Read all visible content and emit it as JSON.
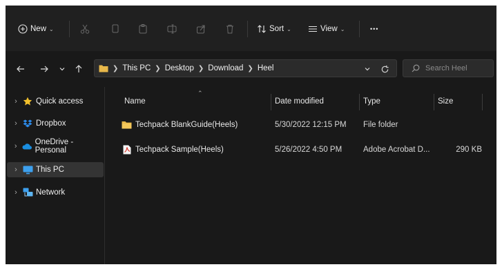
{
  "toolbar": {
    "new_label": "New",
    "sort_label": "Sort",
    "view_label": "View",
    "more_label": "•••"
  },
  "address": {
    "crumbs": [
      "This PC",
      "Desktop",
      "Download",
      "Heel"
    ]
  },
  "search": {
    "placeholder": "Search Heel"
  },
  "sidebar": {
    "items": [
      {
        "label": "Quick access",
        "icon": "star-icon"
      },
      {
        "label": "Dropbox",
        "icon": "dropbox-icon"
      },
      {
        "label": "OneDrive - Personal",
        "icon": "cloud-icon"
      },
      {
        "label": "This PC",
        "icon": "monitor-icon"
      },
      {
        "label": "Network",
        "icon": "network-icon"
      }
    ]
  },
  "columns": {
    "name": "Name",
    "date": "Date modified",
    "type": "Type",
    "size": "Size"
  },
  "files": [
    {
      "name": "Techpack BlankGuide(Heels)",
      "date": "5/30/2022 12:15 PM",
      "type": "File folder",
      "size": "",
      "icon": "folder-icon"
    },
    {
      "name": "Techpack Sample(Heels)",
      "date": "5/26/2022 4:50 PM",
      "type": "Adobe Acrobat D...",
      "size": "290 KB",
      "icon": "pdf-icon"
    }
  ],
  "colors": {
    "accent": "#0078d4",
    "folder": "#e8b84a",
    "star": "#f2c02c",
    "window_bg": "#191919",
    "toolbar_bg": "#202020"
  }
}
